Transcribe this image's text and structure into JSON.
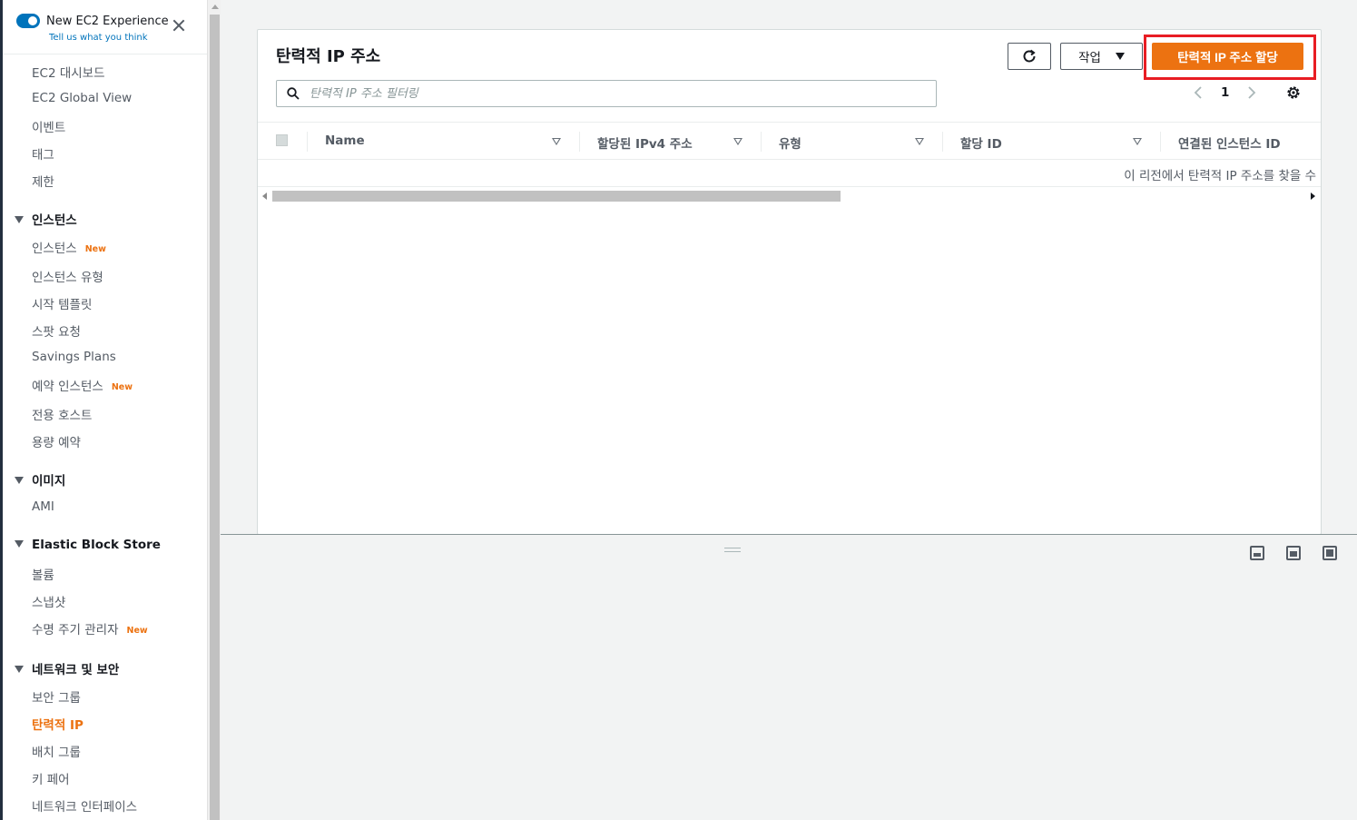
{
  "sidebar": {
    "toggle_title": "New EC2 Experience",
    "toggle_subtitle": "Tell us what you think",
    "new_badge": "New",
    "items": [
      {
        "label": "EC2 대시보드"
      },
      {
        "label": "EC2 Global View"
      },
      {
        "label": "이벤트"
      },
      {
        "label": "태그"
      },
      {
        "label": "제한"
      }
    ],
    "sections": [
      {
        "title": "인스턴스",
        "items": [
          {
            "label": "인스턴스",
            "new": true
          },
          {
            "label": "인스턴스 유형"
          },
          {
            "label": "시작 템플릿"
          },
          {
            "label": "스팟 요청"
          },
          {
            "label": "Savings Plans"
          },
          {
            "label": "예약 인스턴스",
            "new": true
          },
          {
            "label": "전용 호스트"
          },
          {
            "label": "용량 예약"
          }
        ]
      },
      {
        "title": "이미지",
        "items": [
          {
            "label": "AMI"
          }
        ]
      },
      {
        "title": "Elastic Block Store",
        "items": [
          {
            "label": "볼륨"
          },
          {
            "label": "스냅샷"
          },
          {
            "label": "수명 주기 관리자",
            "new": true
          }
        ]
      },
      {
        "title": "네트워크 및 보안",
        "items": [
          {
            "label": "보안 그룹"
          },
          {
            "label": "탄력적 IP",
            "active": true
          },
          {
            "label": "배치 그룹"
          },
          {
            "label": "키 페어"
          },
          {
            "label": "네트워크 인터페이스"
          }
        ]
      }
    ]
  },
  "main": {
    "title": "탄력적 IP 주소",
    "action_label": "작업",
    "allocate_label": "탄력적 IP 주소 할당",
    "search_placeholder": "탄력적 IP 주소 필터링",
    "page_number": "1",
    "columns": [
      "Name",
      "할당된 IPv4 주소",
      "유형",
      "할당 ID",
      "연결된 인스턴스 ID"
    ],
    "empty_message": "이 리전에서 탄력적 IP 주소를 찾을 수"
  },
  "colors": {
    "accent": "#ec7211",
    "link": "#0073bb",
    "highlight": "#e81d24"
  },
  "icons": [
    "close-icon",
    "refresh-icon",
    "caret-down-icon",
    "search-icon",
    "chevron-left-icon",
    "chevron-right-icon",
    "gear-icon",
    "sort-icon"
  ]
}
